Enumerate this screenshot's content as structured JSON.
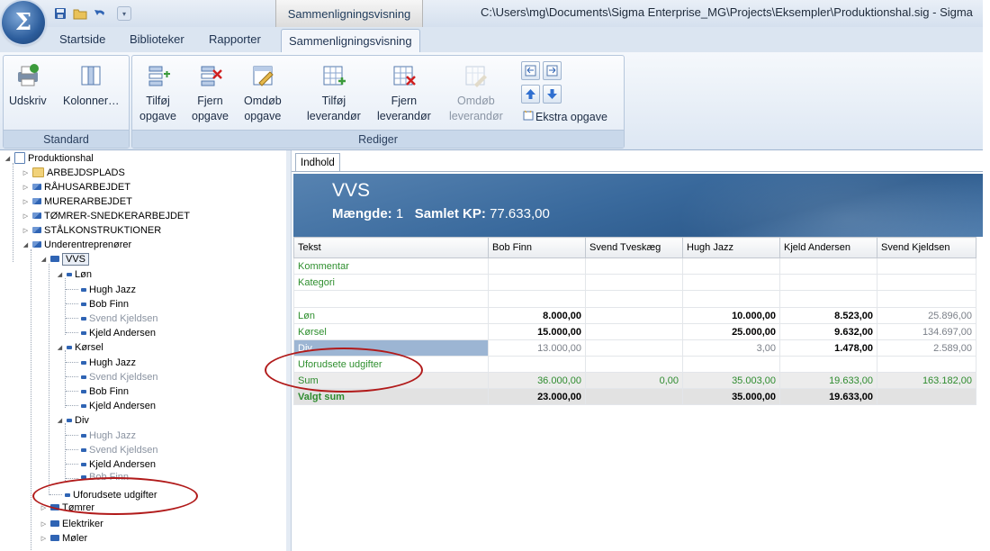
{
  "window": {
    "title_path": "C:\\Users\\mg\\Documents\\Sigma Enterprise_MG\\Projects\\Eksempler\\Produktionshal.sig - Sigma",
    "context_tab_header": "Sammenligningsvisning"
  },
  "ribbon_tabs": [
    "Startside",
    "Biblioteker",
    "Rapporter",
    "Sammenligningsvisning"
  ],
  "ribbon": {
    "groups": {
      "standard": "Standard",
      "rediger": "Rediger"
    },
    "buttons": {
      "udskriv": "Udskriv",
      "kolonner": "Kolonner…",
      "tilfoj_opgave_1": "Tilføj",
      "tilfoj_opgave_2": "opgave",
      "fjern_opgave_1": "Fjern",
      "fjern_opgave_2": "opgave",
      "omdob_opgave_1": "Omdøb",
      "omdob_opgave_2": "opgave",
      "tilfoj_lev_1": "Tilføj",
      "tilfoj_lev_2": "leverandør",
      "fjern_lev_1": "Fjern",
      "fjern_lev_2": "leverandør",
      "omdob_lev_1": "Omdøb",
      "omdob_lev_2": "leverandør",
      "ekstra_opgave": "Ekstra opgave"
    }
  },
  "tree": {
    "root": "Produktionshal",
    "nodes": {
      "arbejdsplads": "ARBEJDSPLADS",
      "raahus": "RÅHUSARBEJDET",
      "murer": "MURERARBEJDET",
      "tomrer_snedker": "TØMRER-SNEDKERARBEJDET",
      "staal": "STÅLKONSTRUKTIONER",
      "underentreprenorer": "Underentreprenører",
      "vvs": "VVS",
      "lon": "Løn",
      "korsel": "Kørsel",
      "div": "Div",
      "uforudsete": "Uforudsete udgifter",
      "tomrer": "Tømrer",
      "elektriker": "Elektriker",
      "moler": "Møler"
    },
    "people": {
      "hugh": "Hugh Jazz",
      "bob": "Bob Finn",
      "svend": "Svend Kjeldsen",
      "kjeld": "Kjeld Andersen"
    }
  },
  "content": {
    "tab": "Indhold",
    "banner": {
      "title": "VVS",
      "maengde_label": "Mængde:",
      "maengde_value": "1",
      "samlet_label": "Samlet KP:",
      "samlet_value": "77.633,00"
    },
    "table": {
      "headers": [
        "Tekst",
        "Bob Finn",
        "Svend Tveskæg",
        "Hugh Jazz",
        "Kjeld Andersen",
        "Svend Kjeldsen"
      ],
      "rows": {
        "kommentar": "Kommentar",
        "kategori": "Kategori",
        "lon": {
          "label": "Løn",
          "bob": "8.000,00",
          "hugh": "10.000,00",
          "kjeld": "8.523,00",
          "svendk": "25.896,00"
        },
        "korsel": {
          "label": "Kørsel",
          "bob": "15.000,00",
          "hugh": "25.000,00",
          "kjeld": "9.632,00",
          "svendk": "134.697,00"
        },
        "div": {
          "label": "Div",
          "bob": "13.000,00",
          "hugh": "3,00",
          "kjeld": "1.478,00",
          "svendk": "2.589,00"
        },
        "uforudsete": {
          "label": "Uforudsete udgifter"
        },
        "sum": {
          "label": "Sum",
          "bob": "36.000,00",
          "svendt": "0,00",
          "hugh": "35.003,00",
          "kjeld": "19.633,00",
          "svendk": "163.182,00"
        },
        "valgt": {
          "label": "Valgt sum",
          "bob": "23.000,00",
          "hugh": "35.000,00",
          "kjeld": "19.633,00"
        }
      }
    }
  }
}
